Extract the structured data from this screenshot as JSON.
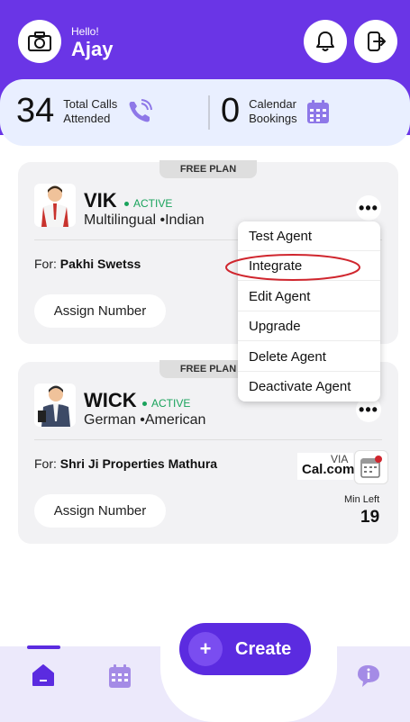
{
  "header": {
    "greeting": "Hello!",
    "user_name": "Ajay"
  },
  "stats": {
    "calls_count": "34",
    "calls_label_1": "Total Calls",
    "calls_label_2": "Attended",
    "bookings_count": "0",
    "bookings_label_1": "Calendar",
    "bookings_label_2": "Bookings"
  },
  "agents": [
    {
      "plan": "FREE PLAN",
      "name": "VIK",
      "status": "ACTIVE",
      "languages": "Multilingual •Indian",
      "for_label": "For:",
      "for_value": "Pakhi Swetss",
      "assign_label": "Assign Number"
    },
    {
      "plan": "FREE PLAN",
      "name": "WICK",
      "status": "ACTIVE",
      "languages": "German •American",
      "for_label": "For:",
      "for_value": "Shri Ji Properties Mathura",
      "assign_label": "Assign Number",
      "integration_via": "VIA",
      "integration_name": "Cal.com",
      "min_left_label": "Min Left",
      "min_left_value": "19"
    }
  ],
  "menu": {
    "items": [
      "Test Agent",
      "Integrate",
      "Edit Agent",
      "Upgrade",
      "Delete Agent",
      "Deactivate Agent"
    ]
  },
  "bottom_nav": {
    "create_label": "Create",
    "plus_glyph": "+"
  },
  "colors": {
    "brand": "#6a35e6",
    "active": "#1aa35c",
    "highlight_circle": "#d0262e",
    "stats_bg": "#e9efff"
  },
  "icons": [
    "camera-icon",
    "bell-icon",
    "logout-icon",
    "phone-icon",
    "calendar-icon",
    "more-dots-icon",
    "home-icon",
    "calendar-nav-icon",
    "chat-info-icon"
  ]
}
